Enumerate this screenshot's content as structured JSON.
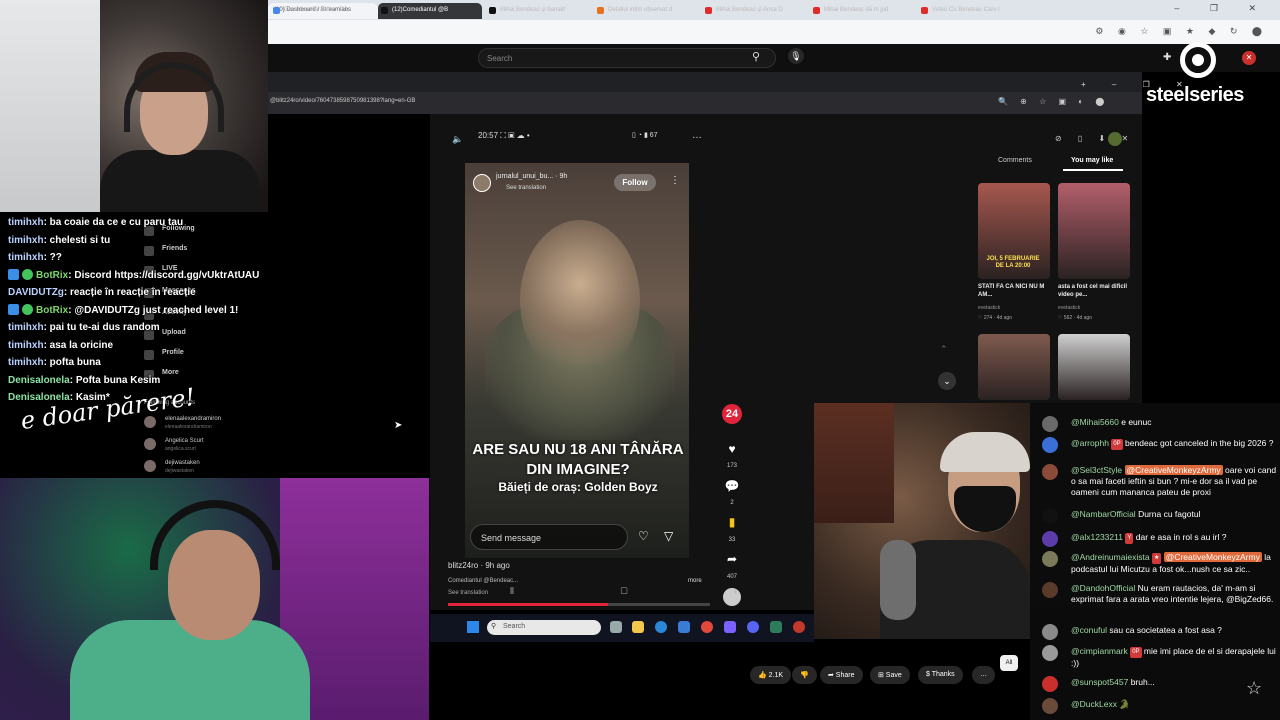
{
  "outer_browser": {
    "tab_title": "(10) Dashboard / Streamlabs",
    "new_tab": "+",
    "window_controls": "– ❐ ✕",
    "toolbar_icons": "⚙ ◉ ☆ ▣ ★ ◆ ↻ ⬤"
  },
  "youtube": {
    "search_placeholder": "Search",
    "search_icon": "search-icon",
    "mic_icon": "mic-icon",
    "right_icons": "✚",
    "close": "✕",
    "actions": [
      {
        "label": "👍 2.1K"
      },
      {
        "label": "👎"
      },
      {
        "label": "➦ Share"
      },
      {
        "label": "⊞ Save"
      },
      {
        "label": "$ Thanks"
      },
      {
        "label": "…"
      }
    ],
    "chip_all": "All"
  },
  "inner_browser": {
    "tabs": [
      {
        "title": "Document fără titlu - Do",
        "color": "#4a86e8"
      },
      {
        "title": "(12)Comediantul @B",
        "color": "#111111"
      },
      {
        "title": "Mihai Bendeac și banalit",
        "color": "#111111"
      },
      {
        "title": "Detaliul intim observat d",
        "color": "#e8711c"
      },
      {
        "title": "Mihai Bendeac și Anca D",
        "color": "#e02b2b"
      },
      {
        "title": "Mihai Bendeac dă în jud",
        "color": "#e02b2b"
      },
      {
        "title": "Video Cu Bendeac Care l",
        "color": "#e02b2b"
      }
    ],
    "window_controls": "+   –  ❐  ✕",
    "url": "@blitz24ro/video/7604738598750981398?lang=en-GB",
    "addr_icons": "🔍 ⊕ ☆ ▣ ◐ ⬤"
  },
  "tiktok": {
    "status_time": "20:57 ⛶ ▣ ☁ •",
    "status_right": "▯ ◔ ▮ 67",
    "volume_icon": "speaker-icon",
    "more": "…",
    "creator": "jurnalul_unui_bu...",
    "creator_time": "9h",
    "see_translation": "See translation",
    "follow": "Follow",
    "caption_main": "ARE SAU NU 18 ANI TÂNĂRA DIN IMAGINE?",
    "caption_sub": "Băieți de oraș: Golden Boyz",
    "send_message": "Send message",
    "likes": "173",
    "comments": "2",
    "saves": "33",
    "shares": "407",
    "avatar_badge": "24",
    "video_user": "blitz24ro · 9h ago",
    "video_desc": "Comediantul @Bendeac...",
    "video_desc_more": "more",
    "video_see_translation": "See translation",
    "progress": 0.61,
    "nav": [
      {
        "label": "Following"
      },
      {
        "label": "Friends"
      },
      {
        "label": "LIVE"
      },
      {
        "label": "Messages"
      },
      {
        "label": "Activity"
      },
      {
        "label": "Upload"
      },
      {
        "label": "Profile"
      },
      {
        "label": "More"
      }
    ],
    "following_accounts_label": "Following accounts",
    "accounts": [
      {
        "name": "elenaalexandramiron",
        "handle": "elenaalexandramiron"
      },
      {
        "name": "Angelica Scurt",
        "handle": "angelica.scurt"
      },
      {
        "name": "dejiwastaken",
        "handle": "dejiwastaken"
      }
    ],
    "panel_tabs": {
      "comments": "Comments",
      "you_may_like": "You may like"
    },
    "panel_icons": "⊘ ▯ ⬇ ✕",
    "suggestions": [
      {
        "title": "STATI FA CA NICI NU M AM...",
        "author": "evetastick",
        "meta": "♡ 274 · 4d ago",
        "color": "#a7584f"
      },
      {
        "title": "asta a fost cel mai dificil video pe...",
        "author": "evetastick",
        "meta": "♡ 562 · 4d ago",
        "color": "#b35f6b"
      },
      {
        "title": "",
        "author": "",
        "meta": "",
        "color": "#7f5a4e"
      },
      {
        "title": "",
        "author": "",
        "meta": "",
        "color": "#cfcfcf"
      }
    ],
    "thumb_overlay": "JOI, 5 FEBRUARIE DE LA 20:00"
  },
  "taskbar": {
    "search_placeholder": "Search"
  },
  "chat_left": [
    {
      "user": "timihxh",
      "msg": "ba coaie da ce e cu paru tau",
      "type": "user"
    },
    {
      "user": "timihxh",
      "msg": "chelesti si tu",
      "type": "user"
    },
    {
      "user": "timihxh",
      "msg": "??",
      "type": "user"
    },
    {
      "user": "BotRix",
      "msg": "Discord https://discord.gg/vUktrAtUAU",
      "type": "bot"
    },
    {
      "user": "DAVIDUTZg",
      "msg": "reacție în reacție în reacție",
      "type": "user"
    },
    {
      "user": "BotRix",
      "msg": "@DAVIDUTZg just reached level 1!",
      "type": "bot"
    },
    {
      "user": "timihxh",
      "msg": "pai tu te-ai dus random",
      "type": "user"
    },
    {
      "user": "timihxh",
      "msg": "asa la oricine",
      "type": "user"
    },
    {
      "user": "timihxh",
      "msg": "pofta buna",
      "type": "user"
    },
    {
      "user": "Denisalonela",
      "msg": "Pofta buna Kesim",
      "type": "user2"
    },
    {
      "user": "Denisalonela",
      "msg": "Kasim*",
      "type": "user2"
    }
  ],
  "handwriting": "e doar părere!",
  "chat_right": [
    {
      "user": "@Mihai5660",
      "badge": "",
      "mention": "",
      "msg": "e eunuc",
      "avatar": "#6a6a6a"
    },
    {
      "user": "@arrophh",
      "badge": "0P",
      "mention": "",
      "msg": "bendeac got canceled in the big 2026 ?",
      "avatar": "#3b6fd8"
    },
    {
      "user": "@Sel3ctStyle",
      "badge": "",
      "mention": "@CreativeMonkeyzArmy",
      "msg": "oare voi cand o sa mai faceti ieftin si bun ? mi-e dor sa il vad pe oameni cum mananca pateu de proxi",
      "avatar": "#8a4b3a"
    },
    {
      "user": "@NambarOfficial",
      "badge": "",
      "mention": "",
      "msg": "Durna cu fagotul",
      "avatar": "#111111"
    },
    {
      "user": "@alx1233211",
      "badge": "Y",
      "mention": "",
      "msg": "dar e asa in rol s au irl ?",
      "avatar": "#5b3ca8"
    },
    {
      "user": "@Andreinumaiexista",
      "badge": "★",
      "mention": "@CreativeMonkeyzArmy",
      "msg": "la podcastul lui Micutzu a fost ok...nush ce sa zic..",
      "avatar": "#7a7a5a"
    },
    {
      "user": "@DandohOfficial",
      "badge": "",
      "mention": "",
      "msg": "Nu eram rautacios, da' m-am si exprimat fara a arata vreo intentie lejera, @BigZed66.",
      "avatar": "#5a3a2a"
    },
    {
      "user": "@conuful",
      "badge": "",
      "mention": "",
      "msg": "sau ca societatea a fost asa ?",
      "avatar": "#8a8a8a"
    },
    {
      "user": "@cimpianmark",
      "badge": "0P",
      "mention": "",
      "msg": "mie imi place de el si derapajele lui :))",
      "avatar": "#9a9a9a"
    },
    {
      "user": "@sunspot5457",
      "badge": "",
      "mention": "",
      "msg": "bruh...",
      "avatar": "#c9302c"
    },
    {
      "user": "@DuckLexx",
      "badge": "",
      "mention": "",
      "msg": "🐊",
      "avatar": "#6a4a3a"
    }
  ],
  "steelseries": {
    "wordmark": "steelseries"
  },
  "colors": {
    "tiktok_red": "#e0243c",
    "chat_bg": "#0c0c0c",
    "youtube_bg": "#0f0f0f"
  }
}
